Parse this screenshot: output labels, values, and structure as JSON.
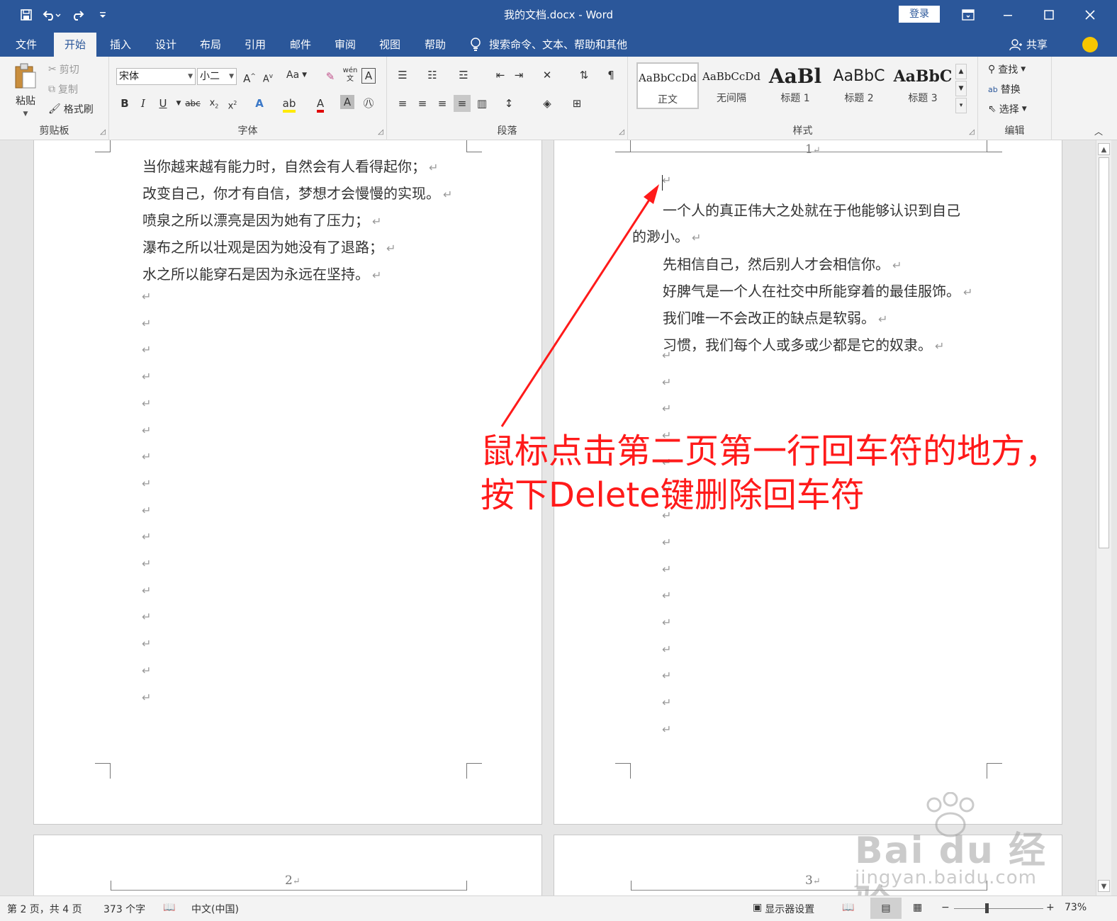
{
  "window": {
    "title": "我的文档.docx  -  Word",
    "login_label": "登录"
  },
  "tabs": [
    "文件",
    "开始",
    "插入",
    "设计",
    "布局",
    "引用",
    "邮件",
    "审阅",
    "视图",
    "帮助"
  ],
  "active_tab": "开始",
  "tell_me": "搜索命令、文本、帮助和其他",
  "share_label": "共享",
  "ribbon": {
    "clipboard": {
      "label": "剪贴板",
      "paste": "粘贴",
      "cut": "剪切",
      "copy": "复制",
      "format_painter": "格式刷"
    },
    "font": {
      "label": "字体",
      "font_name": "宋体",
      "font_size": "小二",
      "aa": "Aa",
      "wen": "wén"
    },
    "paragraph": {
      "label": "段落"
    },
    "styles": {
      "label": "样式",
      "items": [
        {
          "sample": "AaBbCcDd",
          "name": "正文"
        },
        {
          "sample": "AaBbCcDd",
          "name": "无间隔"
        },
        {
          "sample": "AaBl",
          "name": "标题 1"
        },
        {
          "sample": "AaBbC",
          "name": "标题 2"
        },
        {
          "sample": "AaBbC",
          "name": "标题 3"
        }
      ]
    },
    "editing": {
      "label": "编辑",
      "find": "查找",
      "replace": "替换",
      "select": "选择"
    }
  },
  "pages": {
    "page1_lines": [
      "当你越来越有能力时，自然会有人看得起你；",
      "改变自己，你才有自信，梦想才会慢慢的实现。",
      "喷泉之所以漂亮是因为她有了压力；",
      "瀑布之所以壮观是因为她没有了退路；",
      "水之所以能穿石是因为永远在坚持。"
    ],
    "page2_header": "1",
    "page2_lines": [
      "一个人的真正伟大之处就在于他能够认识到自己",
      "的渺小。",
      "先相信自己，然后别人才会相信你。",
      "好脾气是一个人在社交中所能穿着的最佳服饰。",
      "我们唯一不会改正的缺点是软弱。",
      "习惯，我们每个人或多或少都是它的奴隶。"
    ],
    "page3_header": "2",
    "page4_header": "3",
    "paragraph_mark": "↵"
  },
  "annotation": {
    "line1": "鼠标点击第二页第一行回车符的地方，",
    "line2": "按下Delete键删除回车符",
    "color": "#ff1a1a"
  },
  "watermark": {
    "main": "Bai du 经验",
    "sub": "jingyan.baidu.com"
  },
  "statusbar": {
    "page_info": "第 2 页，共 4 页",
    "word_count": "373 个字",
    "language": "中文(中国)",
    "display_settings": "显示器设置",
    "zoom": "73%"
  },
  "colors": {
    "accent": "#2b579a"
  }
}
